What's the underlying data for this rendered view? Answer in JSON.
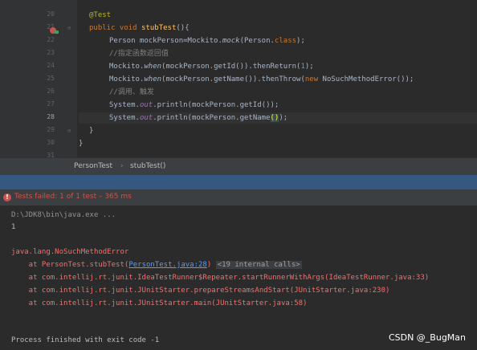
{
  "editor": {
    "lines": [
      {
        "num": "20"
      },
      {
        "num": "21"
      },
      {
        "num": "22"
      },
      {
        "num": "23"
      },
      {
        "num": "24"
      },
      {
        "num": "25"
      },
      {
        "num": "26"
      },
      {
        "num": "27"
      },
      {
        "num": "28"
      },
      {
        "num": "29"
      },
      {
        "num": "30"
      },
      {
        "num": "31"
      }
    ],
    "code": {
      "l20": "@Test",
      "l21_kw": "public void ",
      "l21_fn": "stubTest",
      "l21_rest": "(){",
      "l22_a": "Person mockPerson=Mockito.",
      "l22_b": "mock",
      "l22_c": "(Person.",
      "l22_d": "class",
      "l22_e": ");",
      "l23": "//指定函数返回值",
      "l24_a": "Mockito.",
      "l24_b": "when",
      "l24_c": "(mockPerson.getId()).thenReturn(",
      "l24_d": "1",
      "l24_e": ");",
      "l25_a": "Mockito.",
      "l25_b": "when",
      "l25_c": "(mockPerson.getName()).thenThrow(",
      "l25_d": "new ",
      "l25_e": "NoSuchMethodError());",
      "l26": "//调用、触发",
      "l27_a": "System.",
      "l27_b": "out",
      "l27_c": ".println(mockPerson.getId());",
      "l28_a": "System.",
      "l28_b": "out",
      "l28_c": ".println(mockPerson.getName",
      "l28_d": "()",
      "l28_e": ");",
      "l29": "}",
      "l30": "}"
    }
  },
  "breadcrumb": {
    "class_name": "PersonTest",
    "separator": "›",
    "method_name": "stubTest()"
  },
  "run": {
    "status_icon": "error-icon",
    "status_text": "Tests failed: 1 of 1 test – 365 ms"
  },
  "console": {
    "command": "D:\\JDK8\\bin\\java.exe ...",
    "output_1": "1",
    "exception": "java.lang.NoSuchMethodError",
    "trace1_a": "    at PersonTest.stubTest(",
    "trace1_link": "PersonTest.java:28",
    "trace1_b": ")",
    "trace1_folded": "<19 internal calls>",
    "trace2": "    at com.intellij.rt.junit.IdeaTestRunner$Repeater.startRunnerWithArgs(IdeaTestRunner.java:33)",
    "trace3": "    at com.intellij.rt.junit.JUnitStarter.prepareStreamsAndStart(JUnitStarter.java:230)",
    "trace4": "    at com.intellij.rt.junit.JUnitStarter.main(JUnitStarter.java:58)",
    "exit": "Process finished with exit code -1"
  },
  "watermark": "CSDN @_BugMan",
  "colors": {
    "background": "#2b2b2b",
    "error": "#ff6b68",
    "link": "#589df6",
    "annotation": "#bbb529",
    "keyword": "#cc7832"
  }
}
